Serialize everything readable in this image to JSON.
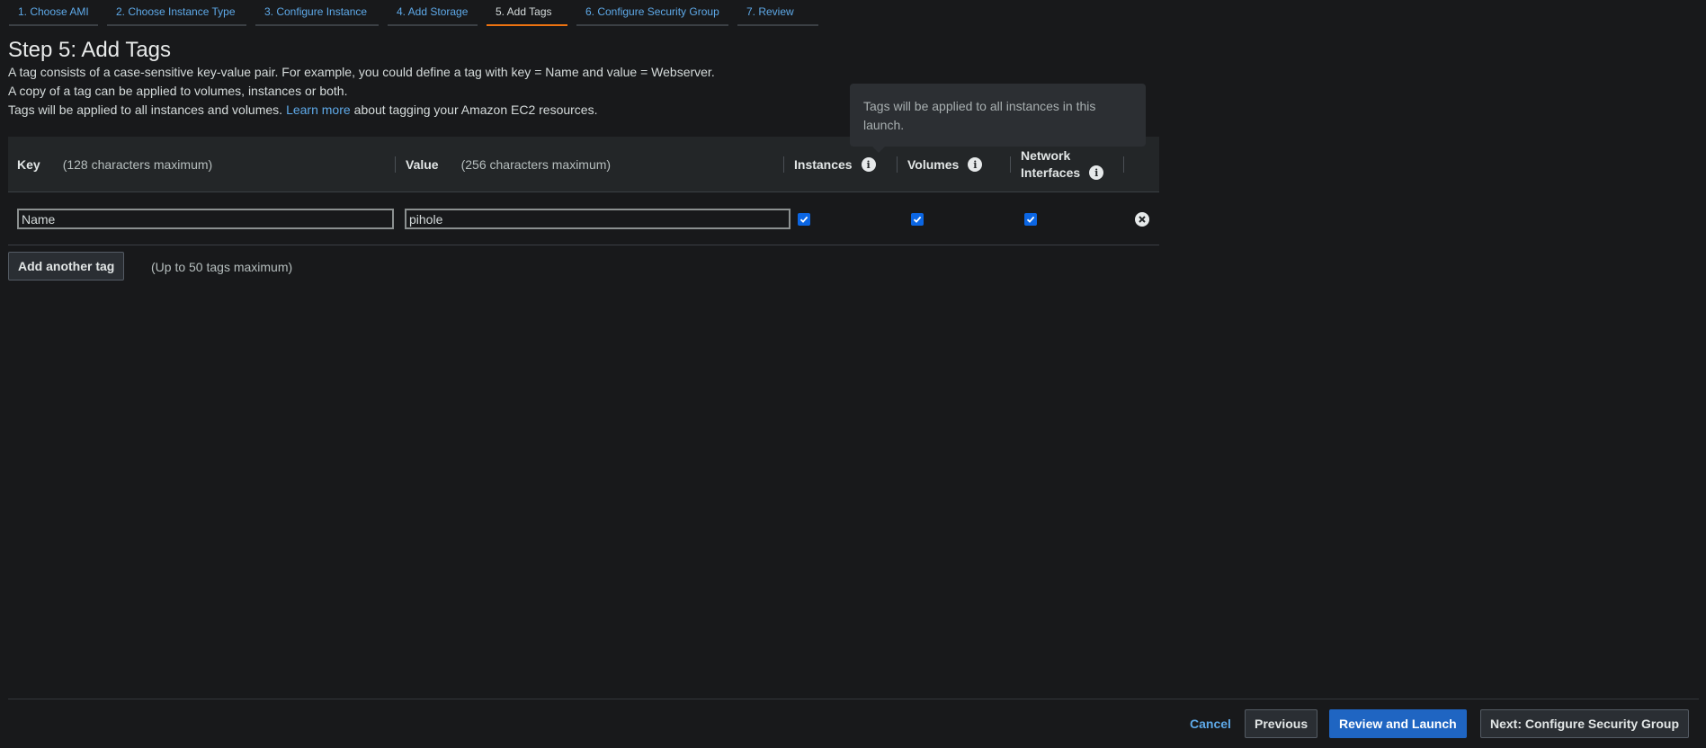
{
  "wizard": {
    "steps": [
      {
        "label": "1. Choose AMI"
      },
      {
        "label": "2. Choose Instance Type"
      },
      {
        "label": "3. Configure Instance"
      },
      {
        "label": "4. Add Storage"
      },
      {
        "label": "5. Add Tags"
      },
      {
        "label": "6. Configure Security Group"
      },
      {
        "label": "7. Review"
      }
    ],
    "active_step": "5. Add Tags"
  },
  "page": {
    "title": "Step 5: Add Tags",
    "desc_line1": "A tag consists of a case-sensitive key-value pair. For example, you could define a tag with key = Name and value = Webserver.",
    "desc_line2": "A copy of a tag can be applied to volumes, instances or both.",
    "desc_line3_before": "Tags will be applied to all instances and volumes.",
    "learn_more": "Learn more",
    "desc_line3_after": "about tagging your Amazon EC2 resources."
  },
  "table": {
    "headers": {
      "key": "Key",
      "key_hint": "(128 characters maximum)",
      "value": "Value",
      "value_hint": "(256 characters maximum)",
      "instances": "Instances",
      "volumes": "Volumes",
      "network_line1": "Network",
      "network_line2": "Interfaces"
    },
    "rows": [
      {
        "key": "Name",
        "value": "pihole",
        "instances": true,
        "volumes": true,
        "network_interfaces": true
      }
    ]
  },
  "tooltip": {
    "text": "Tags will be applied to all instances in this launch."
  },
  "add_tag": {
    "button": "Add another tag",
    "hint": "(Up to 50 tags maximum)"
  },
  "footer": {
    "cancel": "Cancel",
    "previous": "Previous",
    "review_launch": "Review and Launch",
    "next": "Next: Configure Security Group"
  },
  "colors": {
    "background": "#18191b",
    "link": "#5ea9e8",
    "active_tab_underline": "#ec7211",
    "primary_button": "#1f65c2",
    "checkbox": "#0b66e4"
  }
}
